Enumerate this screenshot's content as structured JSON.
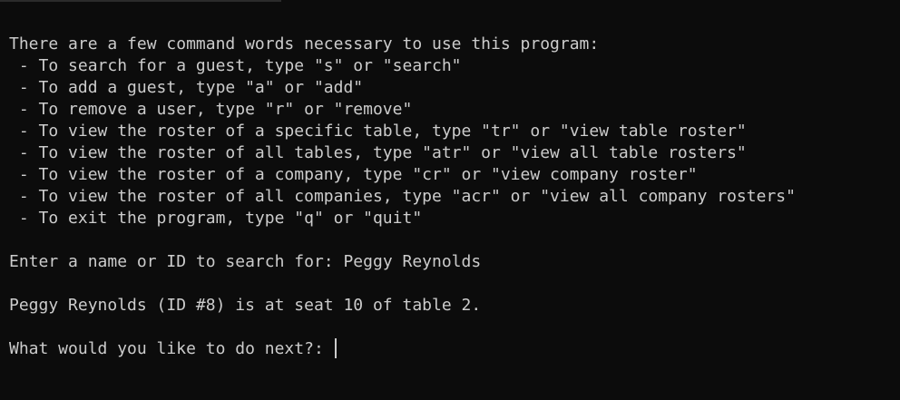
{
  "terminal": {
    "intro": "There are a few command words necessary to use this program:",
    "commands": [
      " - To search for a guest, type \"s\" or \"search\"",
      " - To add a guest, type \"a\" or \"add\"",
      " - To remove a user, type \"r\" or \"remove\"",
      " - To view the roster of a specific table, type \"tr\" or \"view table roster\"",
      " - To view the roster of all tables, type \"atr\" or \"view all table rosters\"",
      " - To view the roster of a company, type \"cr\" or \"view company roster\"",
      " - To view the roster of all companies, type \"acr\" or \"view all company rosters\"",
      " - To exit the program, type \"q\" or \"quit\""
    ],
    "search_prompt": "Enter a name or ID to search for: ",
    "search_input": "Peggy Reynolds",
    "search_result": "Peggy Reynolds (ID #8) is at seat 10 of table 2.",
    "next_prompt": "What would you like to do next?: ",
    "next_input": ""
  },
  "colors": {
    "background": "#0c0c0c",
    "text": "#cccccc"
  }
}
